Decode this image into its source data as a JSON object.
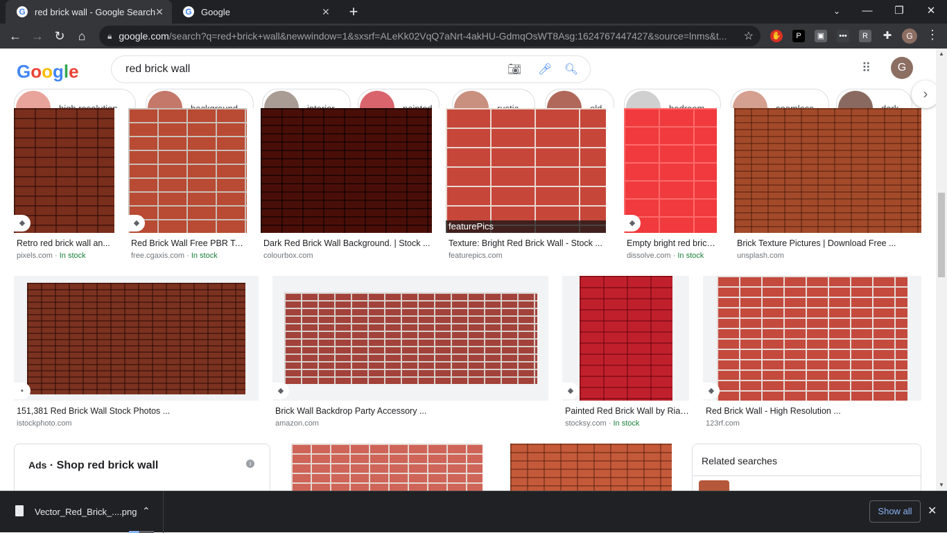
{
  "browser": {
    "tabs": [
      {
        "title": "red brick wall - Google Search",
        "active": true
      },
      {
        "title": "Google",
        "active": false
      }
    ],
    "url_host": "google.com",
    "url_rest": "/search?q=red+brick+wall&newwindow=1&sxsrf=ALeKk02VqQ7aNrt-4akHU-GdmqOsWT8Asg:1624767447427&source=lnms&t...",
    "profile_initial": "G"
  },
  "google": {
    "query": "red brick wall",
    "avatar_initial": "G"
  },
  "chips": [
    {
      "label": "high resolution",
      "color": "#e8a49a"
    },
    {
      "label": "background",
      "color": "#c4786a"
    },
    {
      "label": "interior",
      "color": "#a89c94"
    },
    {
      "label": "painted",
      "color": "#d9646b"
    },
    {
      "label": "rustic",
      "color": "#c99080"
    },
    {
      "label": "old",
      "color": "#b0685a"
    },
    {
      "label": "bedroom",
      "color": "#d0d0d0"
    },
    {
      "label": "seamless",
      "color": "#d6a090"
    },
    {
      "label": "dark",
      "color": "#8a6a60"
    }
  ],
  "results": [
    {
      "title": "Retro red brick wall an...",
      "source": "pixels.com",
      "stock": "In stock",
      "color": "#7a2e1c",
      "badge": "tag"
    },
    {
      "title": "Red Brick Wall Free PBR Tex...",
      "source": "free.cgaxis.com",
      "stock": "In stock",
      "color": "#b94a33",
      "badge": "tag"
    },
    {
      "title": "Dark Red Brick Wall Background. | Stock ...",
      "source": "colourbox.com",
      "stock": "",
      "color": "#4a0e08",
      "badge": ""
    },
    {
      "title": "Texture: Bright Red Brick Wall - Stock ...",
      "source": "featurepics.com",
      "stock": "",
      "color": "#c7463a",
      "badge": ""
    },
    {
      "title": "Empty bright red brick ...",
      "source": "dissolve.com",
      "stock": "In stock",
      "color": "#f03a3e",
      "badge": "tag"
    },
    {
      "title": "Brick Texture Pictures | Download Free ...",
      "source": "unsplash.com",
      "stock": "",
      "color": "#a34a2a",
      "badge": ""
    },
    {
      "title": "151,381 Red Brick Wall Stock Photos ...",
      "source": "istockphoto.com",
      "stock": "",
      "color": "#7c3220",
      "badge": "image"
    },
    {
      "title": "Brick Wall Backdrop Party Accessory ...",
      "source": "amazon.com",
      "stock": "",
      "color": "#a3423a",
      "badge": "tag"
    },
    {
      "title": "Painted Red Brick Wall by Rial...",
      "source": "stocksy.com",
      "stock": "In stock",
      "color": "#c0202c",
      "badge": "tag"
    },
    {
      "title": "Red Brick Wall - High Resolution ...",
      "source": "123rf.com",
      "stock": "",
      "color": "#c44a3e",
      "badge": "tag"
    }
  ],
  "watermark": "featurePics",
  "ads": {
    "prefix": "Ads",
    "title": "Shop red brick wall"
  },
  "related": {
    "title": "Related searches"
  },
  "more_colors": [
    "#cf6458",
    "#c45a3a"
  ],
  "download": {
    "filename": "Vector_Red_Brick_....png",
    "show_all": "Show all",
    "progress": 0.4
  }
}
